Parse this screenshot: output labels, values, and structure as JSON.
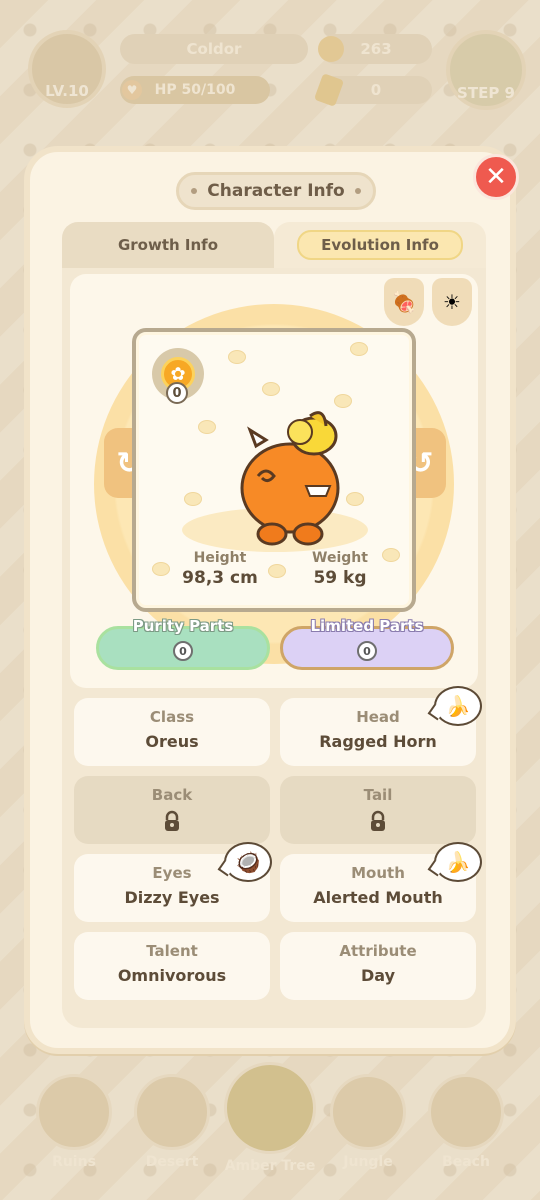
{
  "hud": {
    "level": "LV.10",
    "name": "Coldor",
    "hp": "HP 50/100",
    "coins": "263",
    "tickets": "0",
    "step": "STEP 9"
  },
  "bottom_nav": [
    {
      "label": "Ruins"
    },
    {
      "label": "Desert"
    },
    {
      "label": "Amber Tree"
    },
    {
      "label": "Jungle"
    },
    {
      "label": "Beach"
    }
  ],
  "modal": {
    "title": "Character Info",
    "close_icon": "close-icon",
    "tabs": {
      "growth": "Growth Info",
      "evolution": "Evolution Info",
      "active": "evolution"
    }
  },
  "showcase": {
    "fruit_count": "0",
    "height_label": "Height",
    "height_value": "98,3 cm",
    "weight_label": "Weight",
    "weight_value": "59 kg",
    "purity_label": "Purity Parts",
    "purity_count": "0",
    "limited_label": "Limited Parts",
    "limited_count": "0"
  },
  "attributes": [
    {
      "key": "Class",
      "value": "Oreus",
      "locked": false,
      "badge": ""
    },
    {
      "key": "Head",
      "value": "Ragged Horn",
      "locked": false,
      "badge": "banana-icon"
    },
    {
      "key": "Back",
      "value": "",
      "locked": true,
      "badge": ""
    },
    {
      "key": "Tail",
      "value": "",
      "locked": true,
      "badge": ""
    },
    {
      "key": "Eyes",
      "value": "Dizzy Eyes",
      "locked": false,
      "badge": "coconut-icon"
    },
    {
      "key": "Mouth",
      "value": "Alerted Mouth",
      "locked": false,
      "badge": "banana-icon"
    },
    {
      "key": "Talent",
      "value": "Omnivorous",
      "locked": false,
      "badge": ""
    },
    {
      "key": "Attribute",
      "value": "Day",
      "locked": false,
      "badge": ""
    }
  ],
  "colors": {
    "accent": "#f0c27f",
    "close": "#ef5a4f",
    "purity": "#a9e0c0",
    "limited": "#dcd1f5"
  }
}
